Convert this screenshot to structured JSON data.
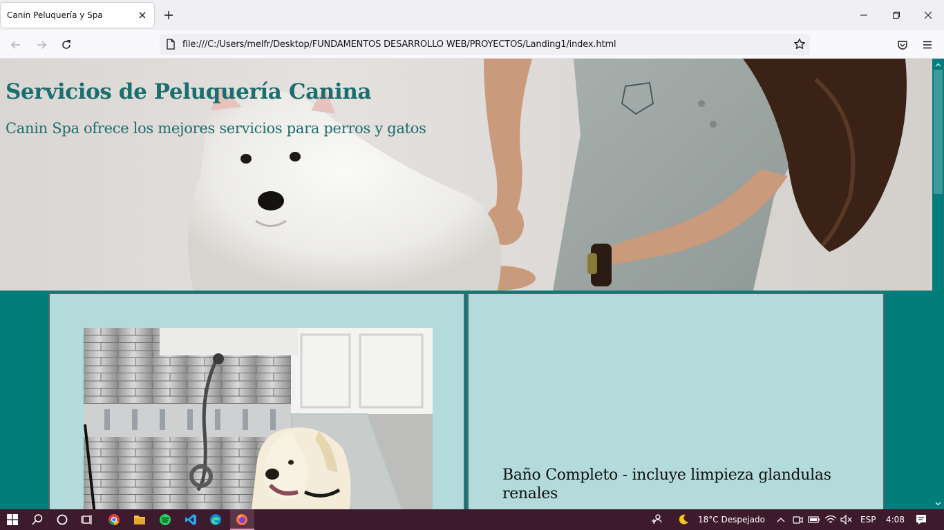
{
  "browser": {
    "tab_title": "Canin Peluquería y Spa",
    "url": "file:///C:/Users/melfr/Desktop/FUNDAMENTOS DESARROLLO WEB/PROYECTOS/Landing1/index.html"
  },
  "page": {
    "hero_title": "Servicios de Peluquería Canina",
    "hero_subtitle": "Canin Spa ofrece los mejores servicios para perros y gatos",
    "service_text": "Baño Completo - incluye limpieza glandulas renales"
  },
  "taskbar": {
    "weather": "18°C  Despejado",
    "language": "ESP",
    "time": "4:08"
  },
  "colors": {
    "page_background": "#037c7c",
    "card_background": "#b4dbdb",
    "heading": "#1c6d6d",
    "taskbar": "#3e1b2c"
  }
}
